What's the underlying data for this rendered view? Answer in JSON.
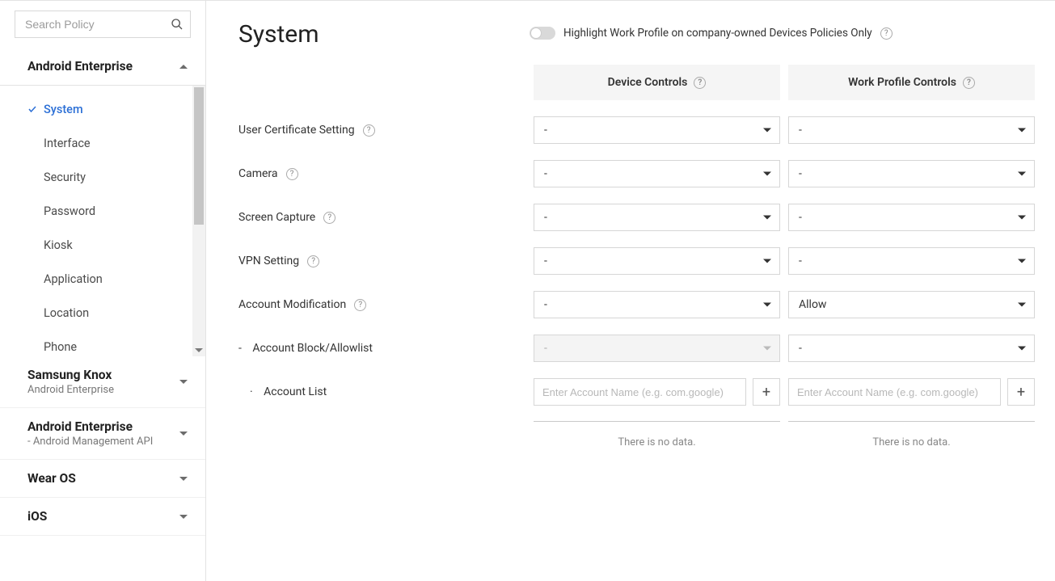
{
  "search": {
    "placeholder": "Search Policy"
  },
  "sidebar": {
    "expanded_group": "Android Enterprise",
    "items": [
      {
        "label": "System",
        "active": true
      },
      {
        "label": "Interface"
      },
      {
        "label": "Security"
      },
      {
        "label": "Password"
      },
      {
        "label": "Kiosk"
      },
      {
        "label": "Application"
      },
      {
        "label": "Location"
      },
      {
        "label": "Phone"
      }
    ],
    "collapsed_groups": [
      {
        "title": "Samsung Knox",
        "sub": "Android Enterprise"
      },
      {
        "title": "Android Enterprise",
        "sub": "- Android Management API"
      },
      {
        "title": "Wear OS",
        "sub": ""
      },
      {
        "title": "iOS",
        "sub": ""
      }
    ]
  },
  "page": {
    "title": "System",
    "highlight_label": "Highlight Work Profile on company-owned Devices Policies Only"
  },
  "columns": {
    "device": "Device Controls",
    "work": "Work Profile Controls"
  },
  "rows": [
    {
      "label": "User Certificate Setting",
      "help": true,
      "device": "-",
      "work": "-"
    },
    {
      "label": "Camera",
      "help": true,
      "device": "-",
      "work": "-"
    },
    {
      "label": "Screen Capture",
      "help": true,
      "device": "-",
      "work": "-"
    },
    {
      "label": "VPN Setting",
      "help": true,
      "device": "-",
      "work": "-"
    },
    {
      "label": "Account Modification",
      "help": true,
      "device": "-",
      "work": "Allow"
    }
  ],
  "sub1": {
    "label": "Account Block/Allowlist",
    "device": "-",
    "device_disabled": true,
    "work": "-"
  },
  "sub2": {
    "label": "Account List",
    "input_placeholder": "Enter Account Name (e.g. com.google)",
    "no_data": "There is no data."
  }
}
